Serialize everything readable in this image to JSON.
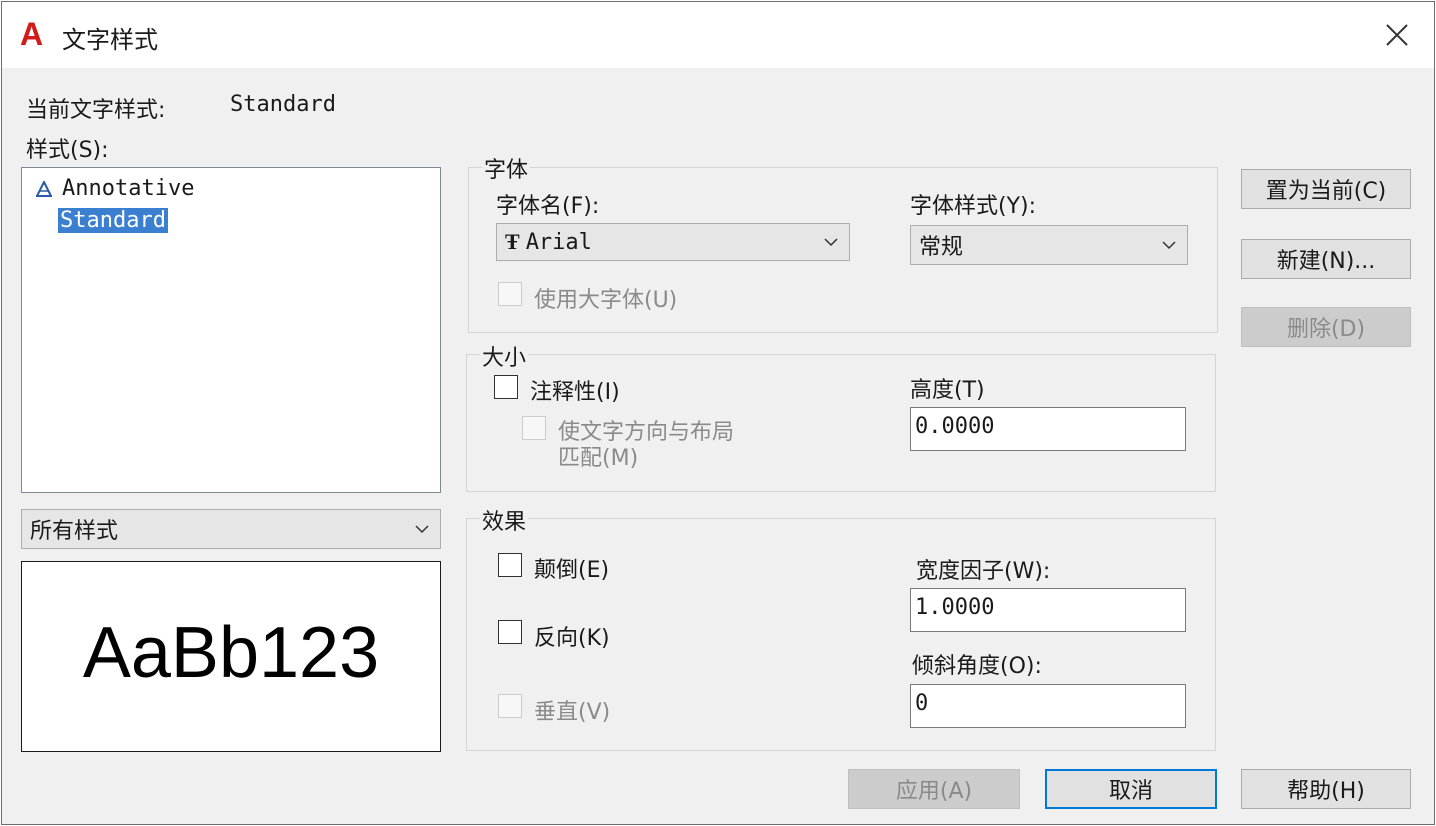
{
  "window": {
    "title": "文字样式",
    "app_icon": "A",
    "close_icon": "close-icon"
  },
  "current_style": {
    "label": "当前文字样式:",
    "value": "Standard"
  },
  "styles": {
    "label": "样式(S):",
    "items": [
      {
        "label": "Annotative",
        "icon": "annotative-icon",
        "selected": false
      },
      {
        "label": "Standard",
        "selected": true
      }
    ],
    "filter_value": "所有样式",
    "preview_text": "AaBb123"
  },
  "font": {
    "group_label": "字体",
    "font_name_label": "字体名(F):",
    "font_name_value": "Arial",
    "font_style_label": "字体样式(Y):",
    "font_style_value": "常规",
    "use_bigfont_label": "使用大字体(U)"
  },
  "size": {
    "group_label": "大小",
    "annotative_label": "注释性(I)",
    "match_orientation_label_1": "使文字方向与布局",
    "match_orientation_label_2": "匹配(M)",
    "height_label": "高度(T)",
    "height_value": "0.0000"
  },
  "effects": {
    "group_label": "效果",
    "upside_down_label": "颠倒(E)",
    "backwards_label": "反向(K)",
    "vertical_label": "垂直(V)",
    "width_factor_label": "宽度因子(W):",
    "width_factor_value": "1.0000",
    "oblique_label": "倾斜角度(O):",
    "oblique_value": "0"
  },
  "buttons": {
    "set_current": "置为当前(C)",
    "new": "新建(N)...",
    "delete": "删除(D)",
    "apply": "应用(A)",
    "cancel": "取消",
    "help": "帮助(H)"
  },
  "colors": {
    "selection": "#3b7fd0",
    "autocad_red": "#d31a1a",
    "default_button_border": "#0078d7"
  }
}
